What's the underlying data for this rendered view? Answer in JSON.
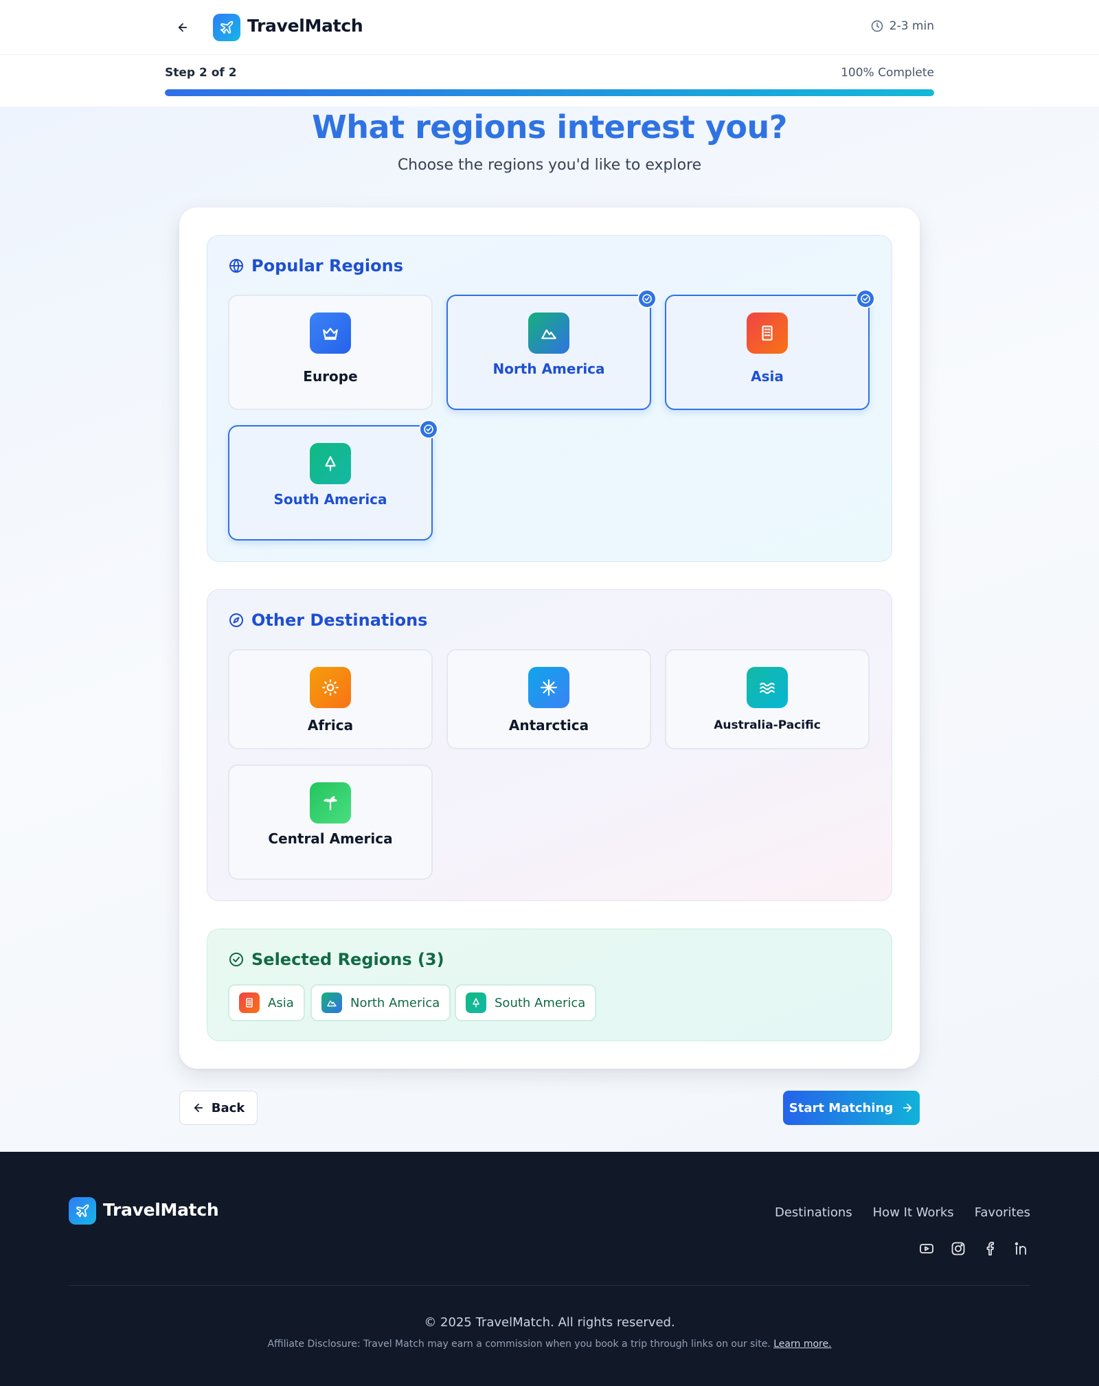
{
  "header": {
    "brand": "TravelMatch",
    "time": "2-3 min"
  },
  "progress": {
    "step": "Step 2 of 2",
    "percent_label": "100% Complete",
    "fraction": 1.0
  },
  "hero": {
    "title": "What regions interest you?",
    "subtitle": "Choose the regions you'd like to explore"
  },
  "popular": {
    "heading": "Popular Regions",
    "tiles": [
      {
        "label": "Europe",
        "selected": false,
        "icon": "crown-icon",
        "color1": "#3b82f6",
        "color2": "#2563eb"
      },
      {
        "label": "North America",
        "selected": true,
        "icon": "mountain-icon",
        "color1": "#16b07a",
        "color2": "#2f73e3"
      },
      {
        "label": "Asia",
        "selected": true,
        "icon": "building-icon",
        "color1": "#ef4444",
        "color2": "#f97316"
      },
      {
        "label": "South America",
        "selected": true,
        "icon": "tree-icon",
        "color1": "#10b981",
        "color2": "#14b8a6"
      }
    ]
  },
  "other": {
    "heading": "Other Destinations",
    "tiles": [
      {
        "label": "Africa",
        "selected": false,
        "icon": "sun-icon",
        "color1": "#f59e0b",
        "color2": "#f97316"
      },
      {
        "label": "Antarctica",
        "selected": false,
        "icon": "snowflake-icon",
        "color1": "#0ea5e9",
        "color2": "#3b82f6"
      },
      {
        "label": "Australia-Pacific",
        "selected": false,
        "icon": "waves-icon",
        "color1": "#14b8a6",
        "color2": "#06b6d4"
      },
      {
        "label": "Central America",
        "selected": false,
        "icon": "palm-icon",
        "color1": "#22c55e",
        "color2": "#4ade80"
      }
    ]
  },
  "selected": {
    "heading": "Selected Regions (3)",
    "chips": [
      {
        "label": "Asia",
        "icon": "building-icon"
      },
      {
        "label": "North America",
        "icon": "mountain-icon"
      },
      {
        "label": "South America",
        "icon": "tree-icon"
      }
    ]
  },
  "buttons": {
    "back": "Back",
    "start": "Start Matching"
  },
  "footer": {
    "brand": "TravelMatch",
    "links": [
      "Destinations",
      "How It Works",
      "Favorites"
    ],
    "social": [
      "youtube-icon",
      "instagram-icon",
      "facebook-icon",
      "linkedin-icon"
    ],
    "copyright": "© 2025 TravelMatch. All rights reserved.",
    "affiliate": "Affiliate Disclosure: Travel Match may earn a commission when you book a trip through links on our site.",
    "learn_more": "Learn more."
  }
}
